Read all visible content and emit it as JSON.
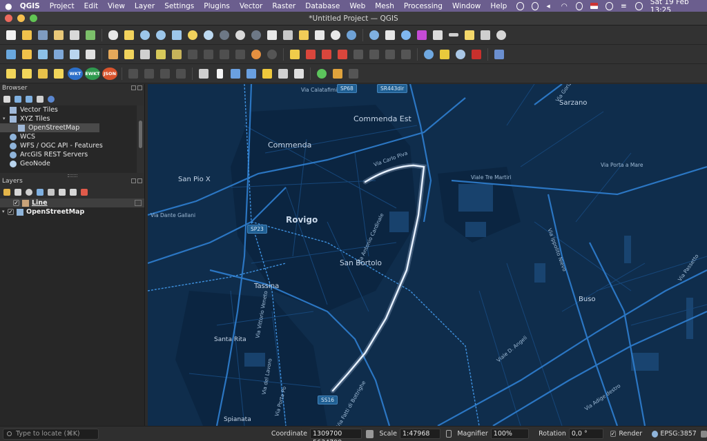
{
  "menubar": {
    "items": [
      "QGIS",
      "Project",
      "Edit",
      "View",
      "Layer",
      "Settings",
      "Plugins",
      "Vector",
      "Raster",
      "Database",
      "Web",
      "Mesh",
      "Processing",
      "Window",
      "Help"
    ],
    "datetime": "Sat 19 Feb  13:25"
  },
  "window": {
    "title": "*Untitled Project — QGIS"
  },
  "browser": {
    "title": "Browser",
    "items": [
      {
        "label": "Vector Tiles",
        "icon": "grid-icon"
      },
      {
        "label": "XYZ Tiles",
        "icon": "grid-icon"
      },
      {
        "label": "OpenStreetMap",
        "icon": "grid-icon"
      },
      {
        "label": "WCS",
        "icon": "globe-icon"
      },
      {
        "label": "WFS / OGC API - Features",
        "icon": "globe-icon"
      },
      {
        "label": "ArcGIS REST Servers",
        "icon": "globe-icon"
      },
      {
        "label": "GeoNode",
        "icon": "geonode-icon"
      }
    ]
  },
  "layers": {
    "title": "Layers",
    "items": [
      {
        "label": "Line",
        "checked": "✓",
        "icon": "line-icon"
      },
      {
        "label": "OpenStreetMap",
        "checked": "✓",
        "icon": "xyz-icon"
      }
    ]
  },
  "map": {
    "places": [
      "Commenda Est",
      "Commenda",
      "Rovigo",
      "San Pio X",
      "San Bortolo",
      "Tassina",
      "Santa Rita",
      "Sarzano",
      "Buso",
      "Spianata"
    ],
    "roads": [
      "Via Calatafimi",
      "Via Porta a Mare",
      "Viale Tre Martiri",
      "Via Dante Gallani",
      "Via Ippolito Nievo",
      "Via Vittorio Veneto",
      "Viale D. Angeli",
      "Via Adige destro",
      "Via Porta Po",
      "Via del Lavoro",
      "Via Passetto",
      "Via Gorizia",
      "Via Fatti di Bottrighe",
      "Via Antonio Cardinale",
      "Via Carlo Piva"
    ],
    "shields": [
      "SP68",
      "SR443dir",
      "SP23",
      "SS16"
    ]
  },
  "status": {
    "locate_placeholder": "Type to locate (⌘K)",
    "coordinate_label": "Coordinate",
    "coordinate": "1309700 5634799",
    "scale_label": "Scale",
    "scale": "1:47968",
    "magnifier_label": "Magnifier",
    "magnifier": "100%",
    "rotation_label": "Rotation",
    "rotation": "0,0 °",
    "render_label": "Render",
    "crs": "EPSG:3857"
  },
  "colors": {
    "map_bg": "#0f2d4c",
    "road": "#2f7fd0",
    "route": "#dfe9f5",
    "menubar": "#6b5e8e"
  }
}
